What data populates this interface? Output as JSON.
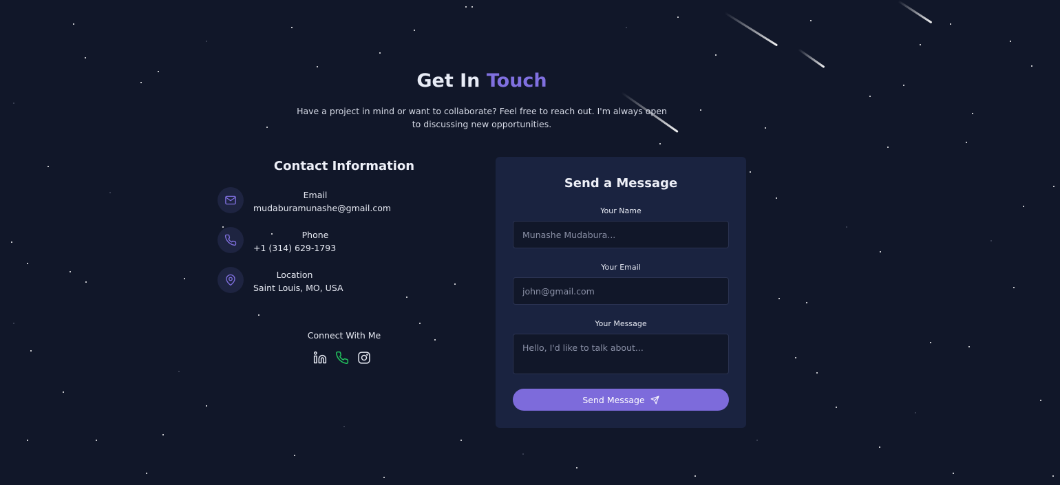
{
  "colors": {
    "background": "#111729",
    "card": "#1a2340",
    "accent": "#8070e0",
    "button": "#7d6bdb",
    "phone_icon_green": "#22c55e"
  },
  "header": {
    "title_prefix": "Get In",
    "title_accent": "Touch",
    "subtitle": "Have a project in mind or want to collaborate? Feel free to reach out. I'm always open to discussing new opportunities."
  },
  "contact": {
    "title": "Contact Information",
    "items": [
      {
        "icon": "mail-icon",
        "label": "Email",
        "value": "mudaburamunashe@gmail.com"
      },
      {
        "icon": "phone-icon",
        "label": "Phone",
        "value": "+1 (314) 629-1793"
      },
      {
        "icon": "map-pin-icon",
        "label": "Location",
        "value": "Saint Louis, MO, USA"
      }
    ],
    "connect_title": "Connect With Me",
    "socials": [
      {
        "icon": "linkedin-icon"
      },
      {
        "icon": "phone-icon"
      },
      {
        "icon": "instagram-icon"
      }
    ]
  },
  "form": {
    "title": "Send a Message",
    "name_label": "Your Name",
    "name_placeholder": "Munashe Mudabura...",
    "email_label": "Your Email",
    "email_placeholder": "john@gmail.com",
    "message_label": "Your Message",
    "message_placeholder": "Hello, I'd like to talk about...",
    "submit_label": "Send Message",
    "submit_icon": "send-icon"
  }
}
